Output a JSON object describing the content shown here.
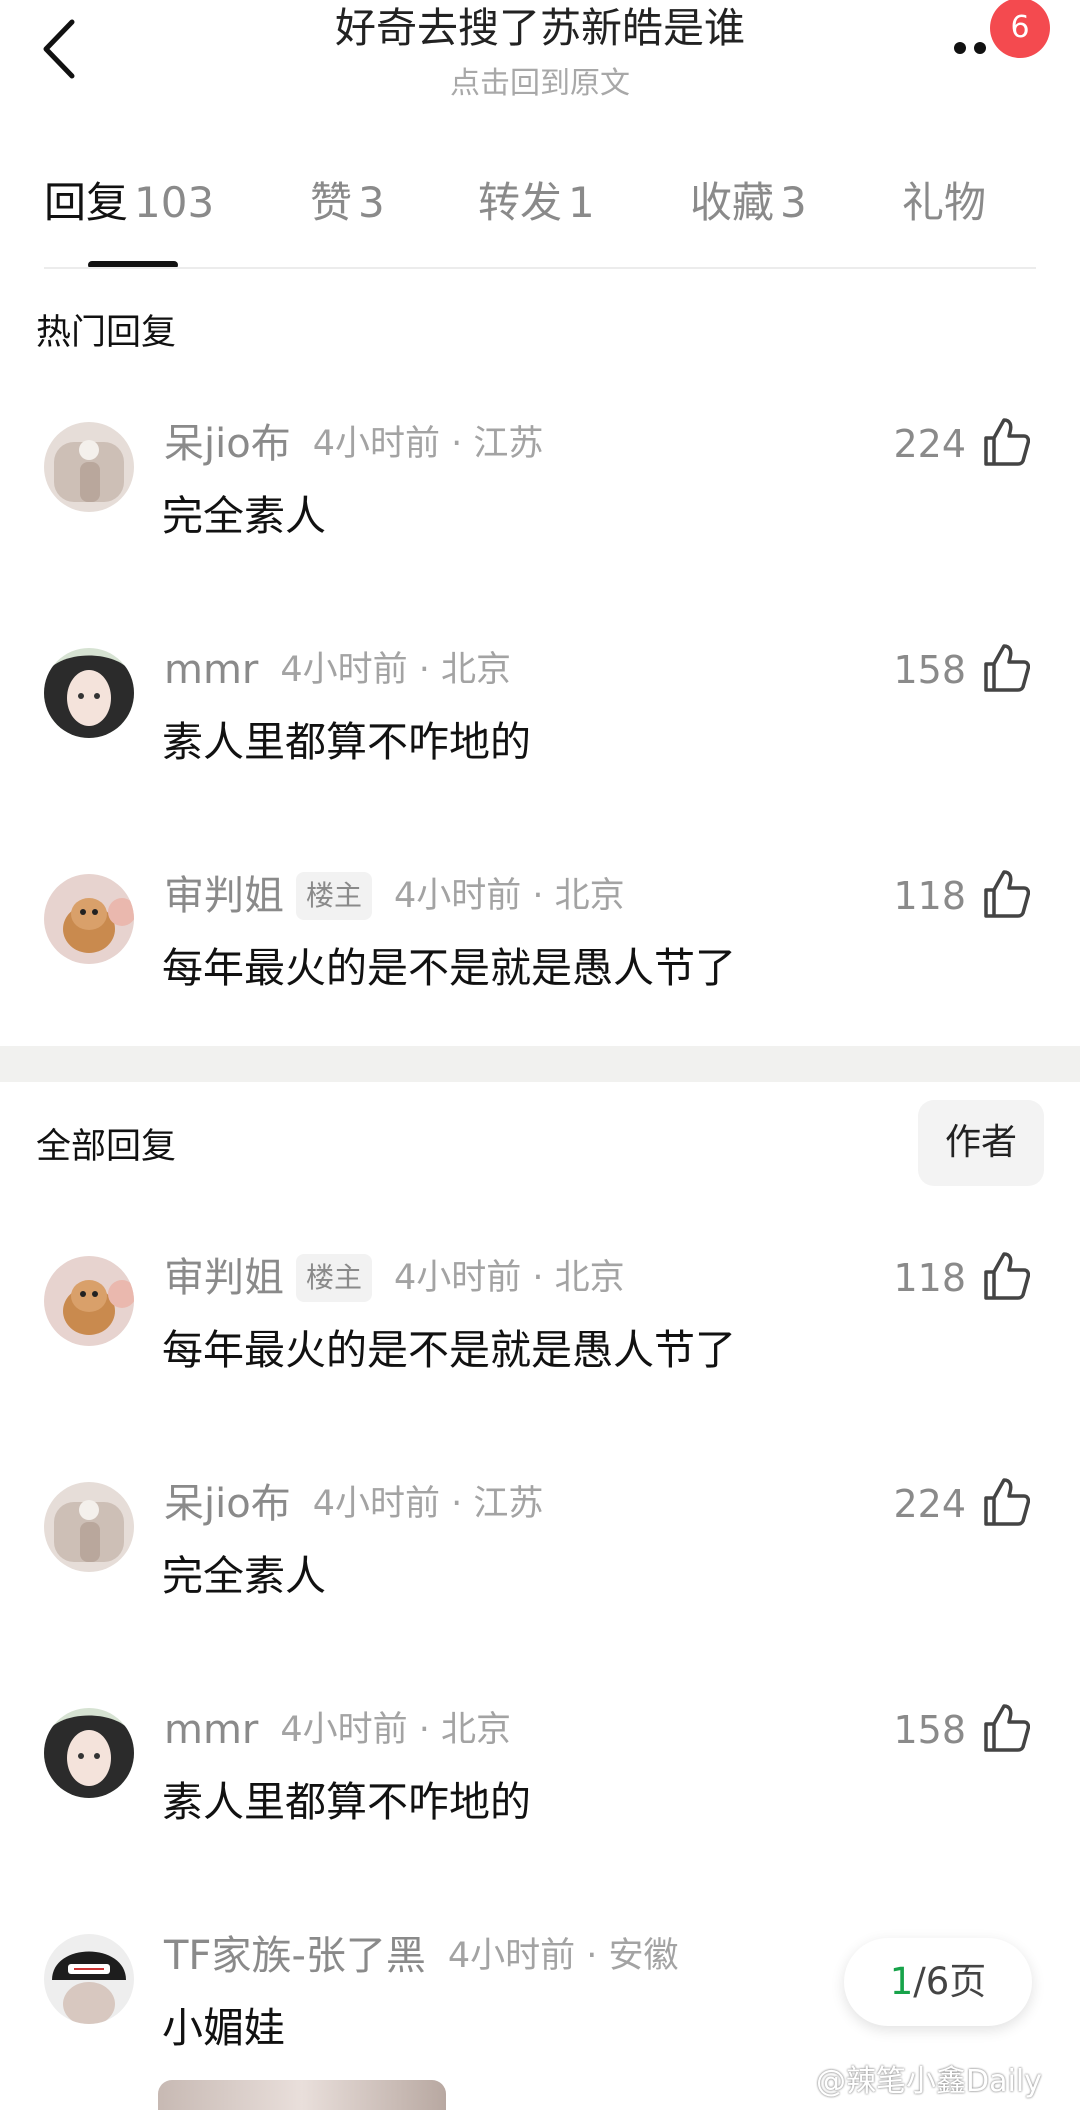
{
  "header": {
    "title": "好奇去搜了苏新皓是谁",
    "subtitle": "点击回到原文",
    "badge_count": "6"
  },
  "tabs": [
    {
      "label": "回复",
      "count": "103",
      "active": true
    },
    {
      "label": "赞",
      "count": "3"
    },
    {
      "label": "转发",
      "count": "1"
    },
    {
      "label": "收藏",
      "count": "3"
    },
    {
      "label": "礼物",
      "count": ""
    }
  ],
  "hot_section": {
    "title": "热门回复",
    "comments": [
      {
        "user": "呆jio布",
        "time": "4小时前 · 江苏",
        "text": "完全素人",
        "likes": "224",
        "avatar": "hand-photo-avatar"
      },
      {
        "user": "mmr",
        "time": "4小时前 · 北京",
        "text": "素人里都算不咋地的",
        "likes": "158",
        "avatar": "girl-photo-avatar"
      },
      {
        "user": "审判姐",
        "tag": "楼主",
        "time": "4小时前 · 北京",
        "text": "每年最火的是不是就是愚人节了",
        "likes": "118",
        "avatar": "puppy-photo-avatar"
      }
    ]
  },
  "all_section": {
    "title": "全部回复",
    "author_filter": "作者",
    "comments": [
      {
        "user": "审判姐",
        "tag": "楼主",
        "time": "4小时前 · 北京",
        "text": "每年最火的是不是就是愚人节了",
        "likes": "118",
        "avatar": "puppy-photo-avatar"
      },
      {
        "user": "呆jio布",
        "time": "4小时前 · 江苏",
        "text": "完全素人",
        "likes": "224",
        "avatar": "hand-photo-avatar"
      },
      {
        "user": "mmr",
        "time": "4小时前 · 北京",
        "text": "素人里都算不咋地的",
        "likes": "158",
        "avatar": "girl-photo-avatar"
      },
      {
        "user": "TF家族-张了黑",
        "time": "4小时前 · 安徽",
        "text": "小媚娃",
        "likes": "",
        "avatar": "capped-person-avatar"
      }
    ]
  },
  "pager": {
    "current": "1",
    "total": "/6页"
  },
  "watermark": "@辣笔小鑫Daily",
  "colors": {
    "badge": "#f44a4f",
    "pager_current": "#17a34a",
    "band": "#f1f1ef"
  }
}
